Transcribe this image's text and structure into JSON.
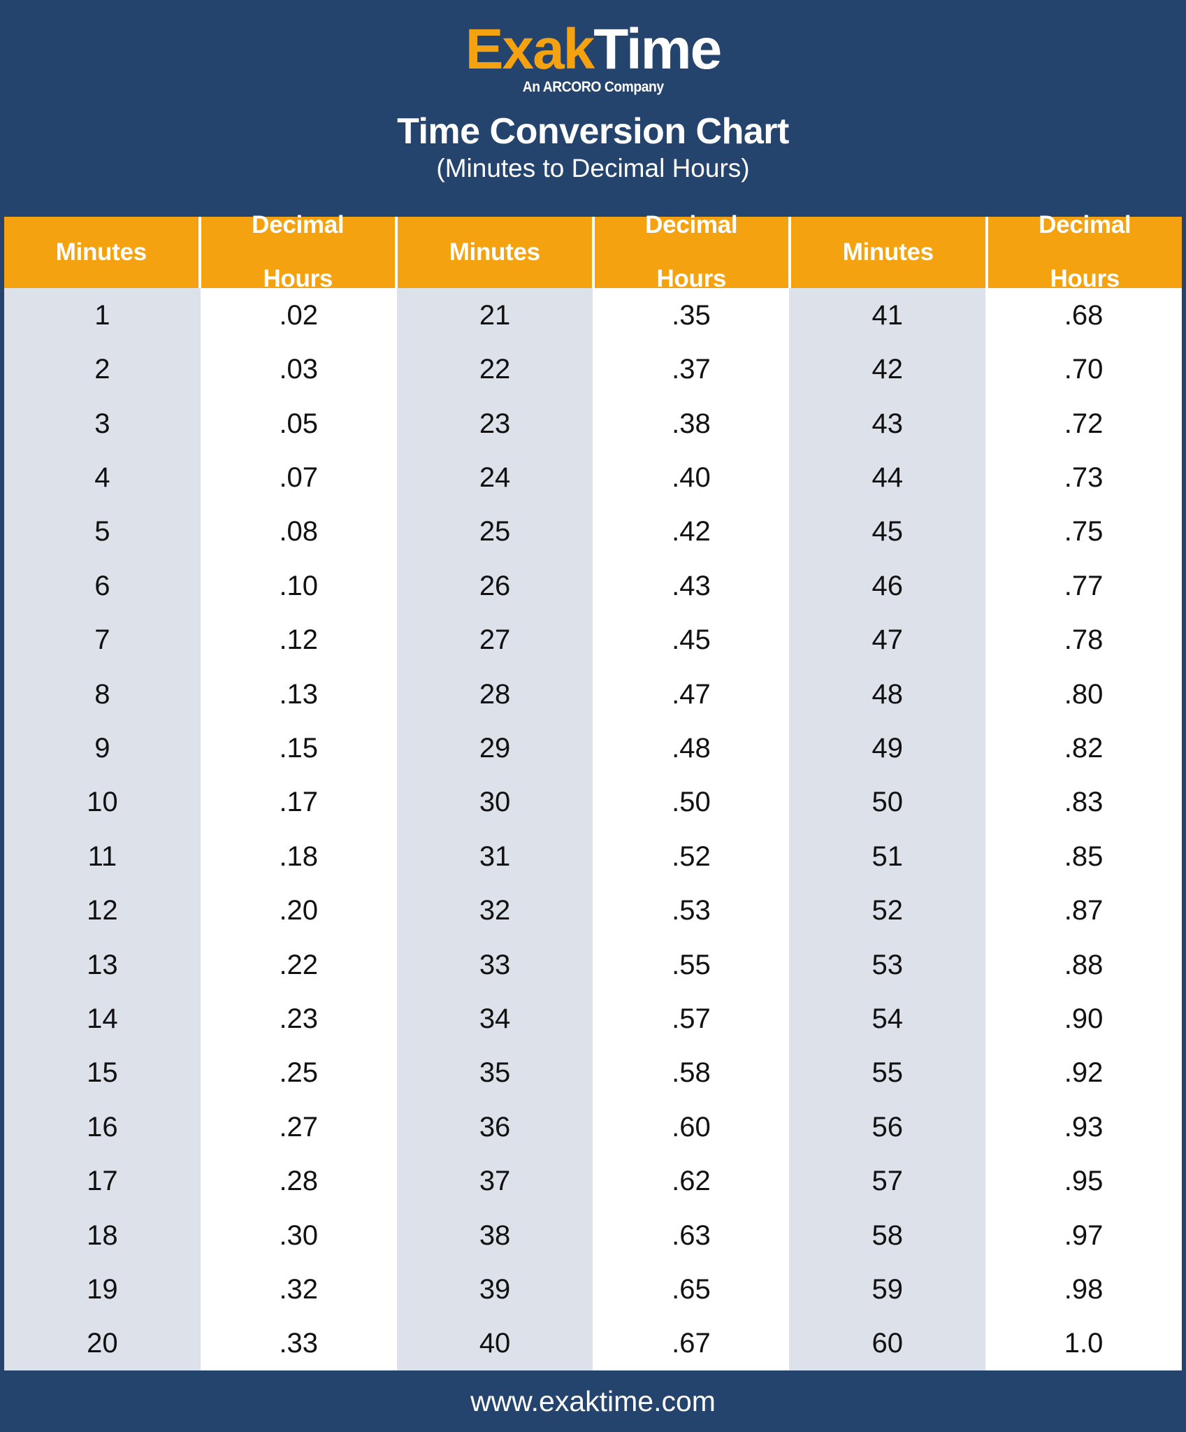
{
  "brand": {
    "logo_part1": "Exak",
    "logo_part2": "Time",
    "tagline": "An ARCORO Company",
    "colors": {
      "navy": "#24446E",
      "orange": "#F5A211",
      "row_shade": "#DCE1EA",
      "row_plain": "#FFFFFF",
      "text": "#111111"
    }
  },
  "header": {
    "title": "Time Conversion Chart",
    "subtitle": "(Minutes to Decimal Hours)"
  },
  "table": {
    "columns": [
      {
        "label_line1": "Minutes",
        "label_line2": "",
        "type": "minutes"
      },
      {
        "label_line1": "Decimal",
        "label_line2": "Hours",
        "type": "decimal"
      },
      {
        "label_line1": "Minutes",
        "label_line2": "",
        "type": "minutes"
      },
      {
        "label_line1": "Decimal",
        "label_line2": "Hours",
        "type": "decimal"
      },
      {
        "label_line1": "Minutes",
        "label_line2": "",
        "type": "minutes"
      },
      {
        "label_line1": "Decimal",
        "label_line2": "Hours",
        "type": "decimal"
      }
    ],
    "col1_minutes": [
      "1",
      "2",
      "3",
      "4",
      "5",
      "6",
      "7",
      "8",
      "9",
      "10",
      "11",
      "12",
      "13",
      "14",
      "15",
      "16",
      "17",
      "18",
      "19",
      "20"
    ],
    "col2_decimal": [
      ".02",
      ".03",
      ".05",
      ".07",
      ".08",
      ".10",
      ".12",
      ".13",
      ".15",
      ".17",
      ".18",
      ".20",
      ".22",
      ".23",
      ".25",
      ".27",
      ".28",
      ".30",
      ".32",
      ".33"
    ],
    "col3_minutes": [
      "21",
      "22",
      "23",
      "24",
      "25",
      "26",
      "27",
      "28",
      "29",
      "30",
      "31",
      "32",
      "33",
      "34",
      "35",
      "36",
      "37",
      "38",
      "39",
      "40"
    ],
    "col4_decimal": [
      ".35",
      ".37",
      ".38",
      ".40",
      ".42",
      ".43",
      ".45",
      ".47",
      ".48",
      ".50",
      ".52",
      ".53",
      ".55",
      ".57",
      ".58",
      ".60",
      ".62",
      ".63",
      ".65",
      ".67"
    ],
    "col5_minutes": [
      "41",
      "42",
      "43",
      "44",
      "45",
      "46",
      "47",
      "48",
      "49",
      "50",
      "51",
      "52",
      "53",
      "54",
      "55",
      "56",
      "57",
      "58",
      "59",
      "60"
    ],
    "col6_decimal": [
      ".68",
      ".70",
      ".72",
      ".73",
      ".75",
      ".77",
      ".78",
      ".80",
      ".82",
      ".83",
      ".85",
      ".87",
      ".88",
      ".90",
      ".92",
      ".93",
      ".95",
      ".97",
      ".98",
      "1.0"
    ]
  },
  "footer": {
    "website": "www.exaktime.com"
  }
}
